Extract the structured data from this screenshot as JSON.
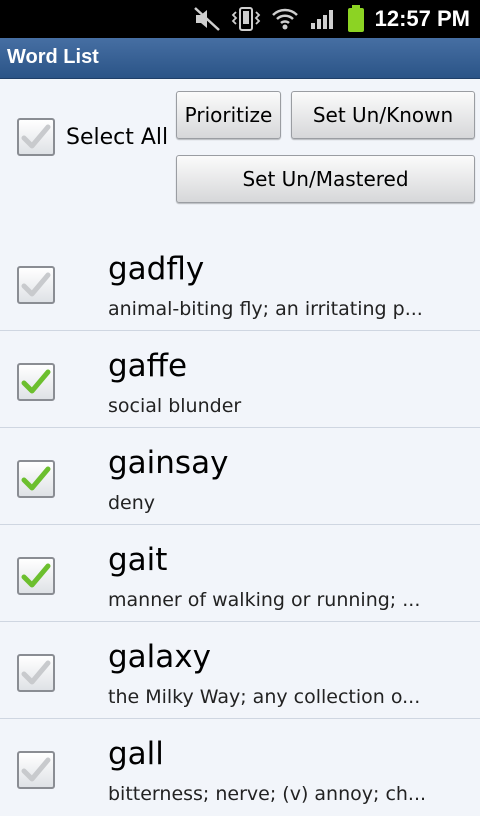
{
  "status_bar": {
    "time": "12:57 PM",
    "icons": [
      "mute-icon",
      "vibrate-icon",
      "wifi-icon",
      "signal-icon",
      "battery-icon"
    ],
    "battery_color": "#8cd323"
  },
  "titlebar": {
    "title": "Word List"
  },
  "controls": {
    "select_all_label": "Select All",
    "select_all_checked": false,
    "prioritize_label": "Prioritize",
    "set_known_label": "Set Un/Known",
    "set_mastered_label": "Set Un/Mastered"
  },
  "colors": {
    "check_on": "#6cbf2e",
    "check_off": "#c8cacd",
    "titlebar": "#3a6398"
  },
  "words": [
    {
      "word": "gadfly",
      "definition": "animal-biting fly; an irritating p...",
      "checked": false
    },
    {
      "word": "gaffe",
      "definition": "social blunder",
      "checked": true
    },
    {
      "word": "gainsay",
      "definition": "deny",
      "checked": true
    },
    {
      "word": "gait",
      "definition": "manner of walking or running; ...",
      "checked": true
    },
    {
      "word": "galaxy",
      "definition": "the Milky Way; any collection o...",
      "checked": false
    },
    {
      "word": "gall",
      "definition": "bitterness; nerve; (v) annoy; ch...",
      "checked": false
    }
  ]
}
